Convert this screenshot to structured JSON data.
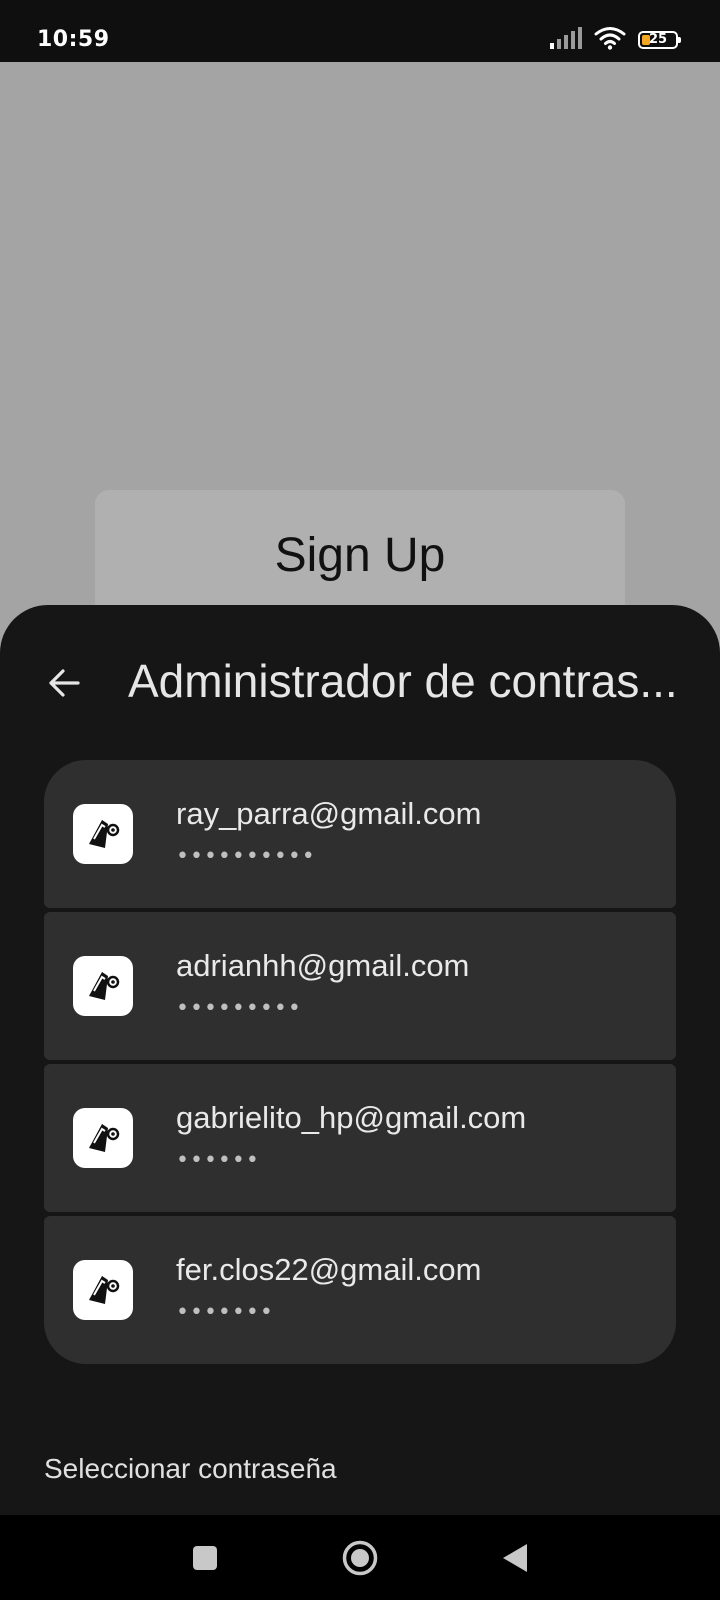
{
  "status_bar": {
    "time": "10:59",
    "battery_level": "25",
    "icons": [
      "signal-icon",
      "wifi-icon",
      "battery-icon"
    ]
  },
  "app": {
    "signup_label": "Sign Up"
  },
  "sheet": {
    "title": "Administrador de contras...",
    "back_icon": "back-arrow-icon",
    "accounts": [
      {
        "email": "ray_parra@gmail.com",
        "password_mask": "••••••••••"
      },
      {
        "email": "adrianhh@gmail.com",
        "password_mask": "•••••••••"
      },
      {
        "email": "gabrielito_hp@gmail.com",
        "password_mask": "••••••"
      },
      {
        "email": "fer.clos22@gmail.com",
        "password_mask": "•••••••"
      }
    ],
    "footer_label": "Seleccionar contraseña"
  },
  "nav_bar": {
    "buttons": [
      "recents-icon",
      "home-icon",
      "back-icon"
    ]
  },
  "colors": {
    "sheet_background": "#161616",
    "list_item_background": "#2f2f2f",
    "backdrop": "#a4a4a4",
    "battery_accent": "#f5a623"
  }
}
